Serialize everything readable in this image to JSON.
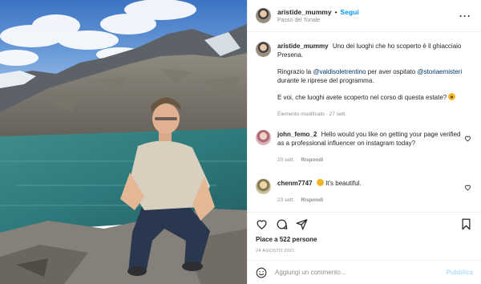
{
  "post": {
    "author": "aristide_mummy",
    "separator": "•",
    "follow_label": "Segui",
    "location": "Passo del Tonale",
    "more_icon": "more-horizontal-icon"
  },
  "caption": {
    "username": "aristide_mummy",
    "line1": "Uno dei luoghi che ho scoperto è il ghiacciaio Presena.",
    "p2_before": "Ringrazio la ",
    "mention1": "@valdisoletrentino",
    "p2_mid": " per aver ospitato ",
    "mention2": "@storiaemisteri",
    "p2_after": " durante le riprese del programma.",
    "p3": "E voi, che luoghi avete scoperto nel corso di questa estate?",
    "meta": "Elemento modificato · 27 sett."
  },
  "comments": [
    {
      "username": "john_femo_2",
      "text": "Hello would you like on getting your page verified as a professional influencer on instagram today?",
      "time": "20 sett.",
      "reply_label": "Rispondi"
    },
    {
      "username": "chenm7747",
      "text": "It's beautiful.",
      "time": "23 sett.",
      "reply_label": "Rispondi"
    }
  ],
  "stats": {
    "likes": "Piace a 522 persone",
    "date": "24 AGOSTO 2021"
  },
  "composer": {
    "placeholder": "Aggiungi un commento...",
    "publish_label": "Pubblica"
  },
  "colors": {
    "accent": "#0095f6",
    "mention": "#00376b",
    "muted": "#8e8e8e",
    "publish_disabled": "#b2dffc"
  }
}
